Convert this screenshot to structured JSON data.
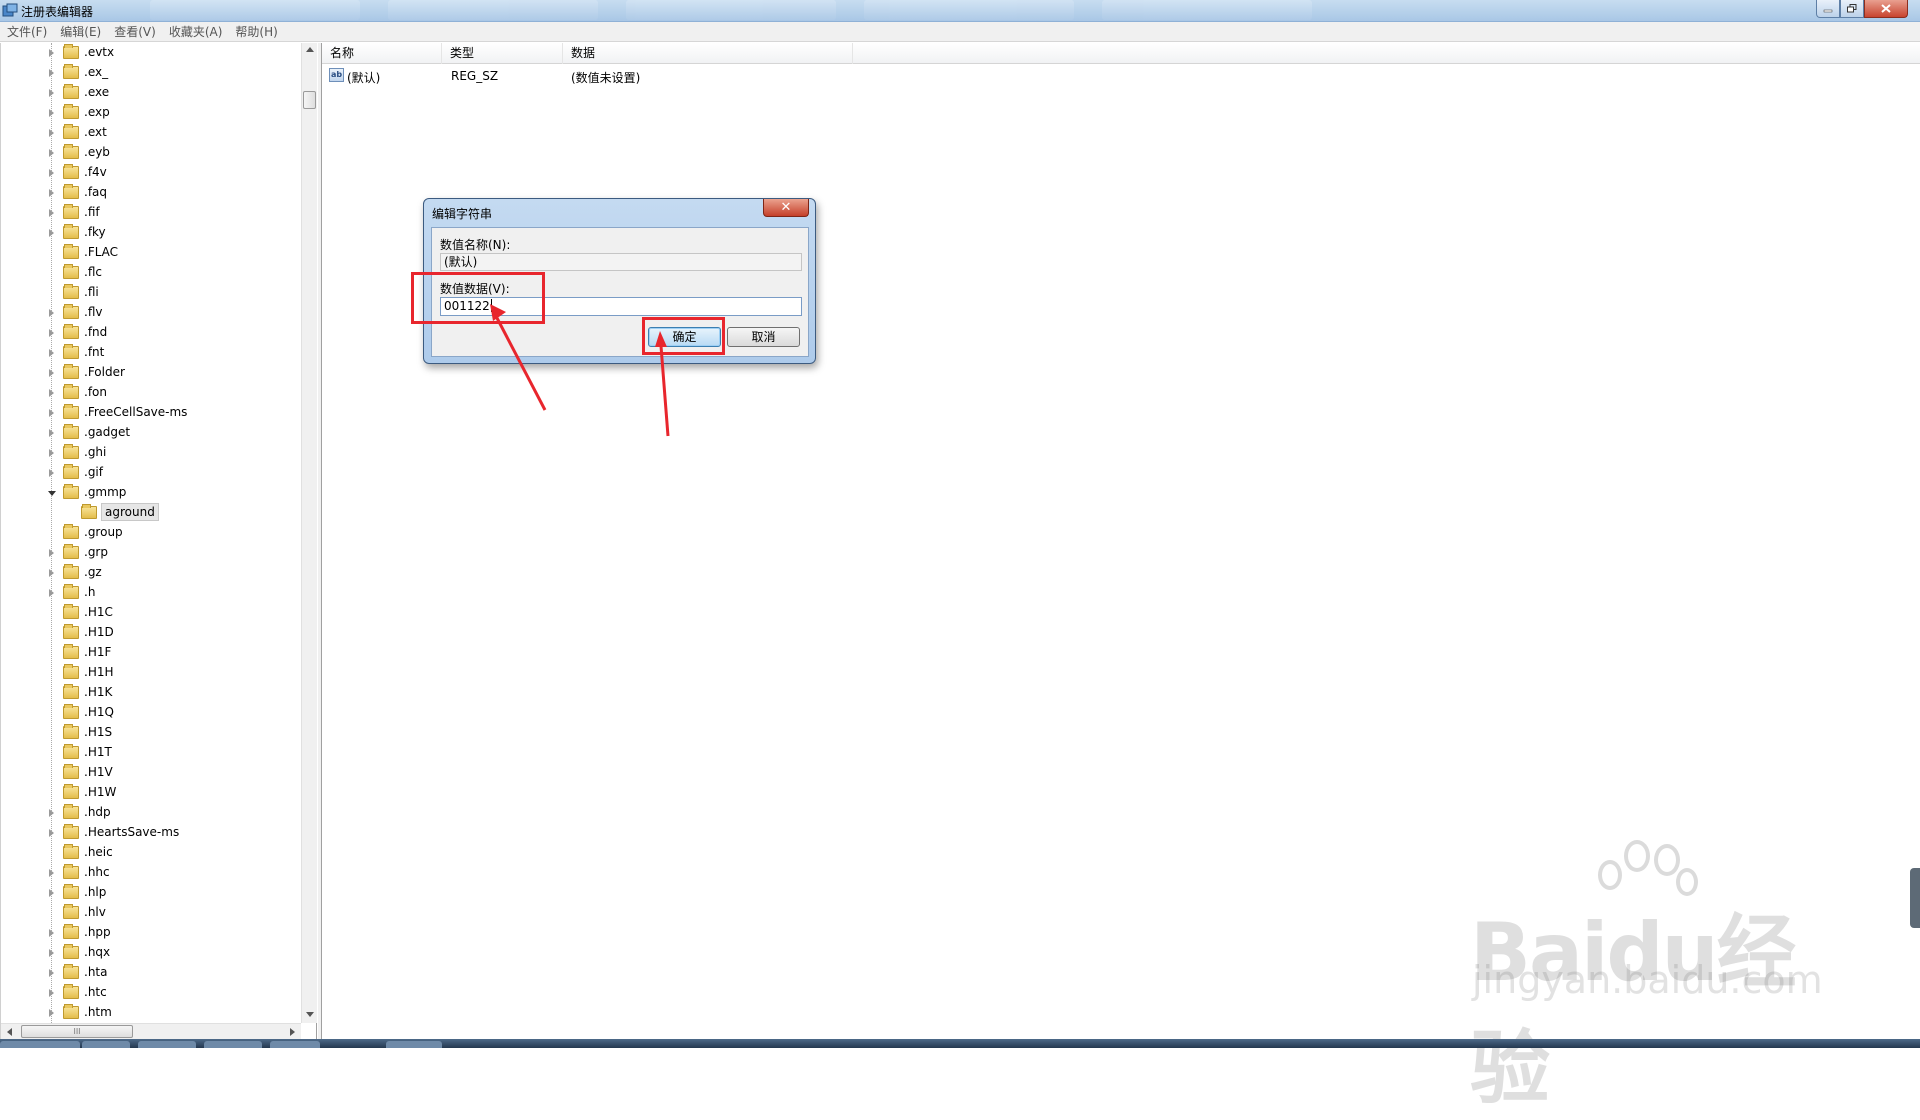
{
  "window": {
    "title": "注册表编辑器"
  },
  "menu": [
    "文件(F)",
    "编辑(E)",
    "查看(V)",
    "收藏夹(A)",
    "帮助(H)"
  ],
  "tree": {
    "items": [
      {
        "label": ".evtx",
        "exp": true
      },
      {
        "label": ".ex_",
        "exp": true
      },
      {
        "label": ".exe",
        "exp": true
      },
      {
        "label": ".exp",
        "exp": true
      },
      {
        "label": ".ext",
        "exp": true
      },
      {
        "label": ".eyb",
        "exp": true
      },
      {
        "label": ".f4v",
        "exp": true
      },
      {
        "label": ".faq",
        "exp": true
      },
      {
        "label": ".fif",
        "exp": true
      },
      {
        "label": ".fky",
        "exp": true
      },
      {
        "label": ".FLAC",
        "exp": false
      },
      {
        "label": ".flc",
        "exp": false
      },
      {
        "label": ".fli",
        "exp": false
      },
      {
        "label": ".flv",
        "exp": true
      },
      {
        "label": ".fnd",
        "exp": true
      },
      {
        "label": ".fnt",
        "exp": true
      },
      {
        "label": ".Folder",
        "exp": true
      },
      {
        "label": ".fon",
        "exp": true
      },
      {
        "label": ".FreeCellSave-ms",
        "exp": true
      },
      {
        "label": ".gadget",
        "exp": true
      },
      {
        "label": ".ghi",
        "exp": true
      },
      {
        "label": ".gif",
        "exp": true
      },
      {
        "label": ".gmmp",
        "exp": true,
        "open": true
      },
      {
        "label": "aground",
        "exp": false,
        "child": true
      },
      {
        "label": ".group",
        "exp": false
      },
      {
        "label": ".grp",
        "exp": true
      },
      {
        "label": ".gz",
        "exp": true
      },
      {
        "label": ".h",
        "exp": true
      },
      {
        "label": ".H1C",
        "exp": false
      },
      {
        "label": ".H1D",
        "exp": false
      },
      {
        "label": ".H1F",
        "exp": false
      },
      {
        "label": ".H1H",
        "exp": false
      },
      {
        "label": ".H1K",
        "exp": false
      },
      {
        "label": ".H1Q",
        "exp": false
      },
      {
        "label": ".H1S",
        "exp": false
      },
      {
        "label": ".H1T",
        "exp": false
      },
      {
        "label": ".H1V",
        "exp": false
      },
      {
        "label": ".H1W",
        "exp": false
      },
      {
        "label": ".hdp",
        "exp": true
      },
      {
        "label": ".HeartsSave-ms",
        "exp": true
      },
      {
        "label": ".heic",
        "exp": false
      },
      {
        "label": ".hhc",
        "exp": true
      },
      {
        "label": ".hlp",
        "exp": true
      },
      {
        "label": ".hlv",
        "exp": false
      },
      {
        "label": ".hpp",
        "exp": true
      },
      {
        "label": ".hqx",
        "exp": true
      },
      {
        "label": ".hta",
        "exp": true
      },
      {
        "label": ".htc",
        "exp": true
      },
      {
        "label": ".htm",
        "exp": true
      }
    ],
    "hscroll_thumb": "III"
  },
  "list": {
    "columns": [
      "名称",
      "类型",
      "数据"
    ],
    "rows": [
      {
        "icon": "ab",
        "name": "(默认)",
        "type": "REG_SZ",
        "data": "(数值未设置)"
      }
    ]
  },
  "dialog": {
    "title": "编辑字符串",
    "close": "✕",
    "name_label": "数值名称(N):",
    "name_value": "(默认)",
    "value_label": "数值数据(V):",
    "value_value": "001122",
    "ok": "确定",
    "cancel": "取消"
  },
  "annotations": {
    "highlight_color": "#e8262d"
  },
  "watermark": {
    "logo": "Baidu经验",
    "url": "jingyan.baidu.com"
  }
}
